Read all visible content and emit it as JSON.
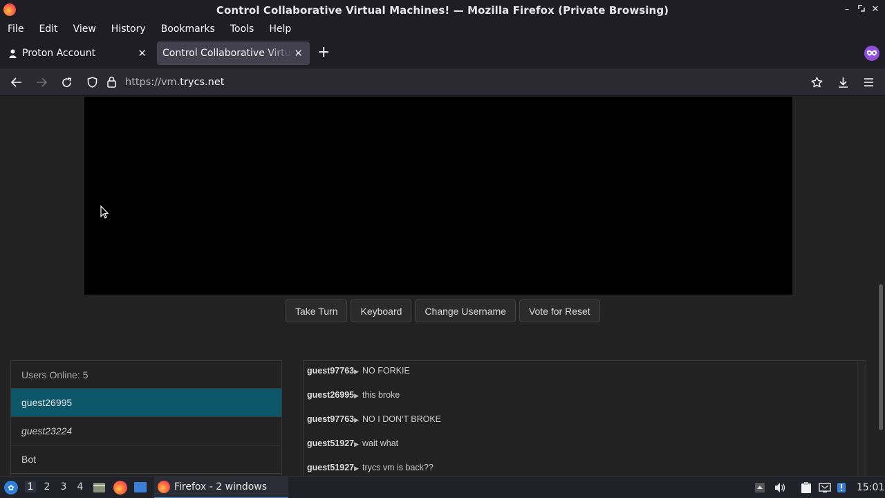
{
  "window": {
    "title": "Control Collaborative Virtual Machines! — Mozilla Firefox (Private Browsing)"
  },
  "menu": {
    "items": [
      "File",
      "Edit",
      "View",
      "History",
      "Bookmarks",
      "Tools",
      "Help"
    ]
  },
  "tabs": [
    {
      "label": "Proton Account",
      "icon": "person-icon",
      "active": false
    },
    {
      "label": "Control Collaborative Virtual Machines!",
      "icon": "none",
      "active": true
    }
  ],
  "nav": {
    "url_prefix": "https://vm.",
    "url_domain": "trycs.net"
  },
  "vm": {
    "buttons": {
      "take_turn": "Take Turn",
      "keyboard": "Keyboard",
      "change_username": "Change Username",
      "vote_reset": "Vote for Reset"
    }
  },
  "users": {
    "header": "Users Online: 5",
    "list": [
      {
        "name": "guest26995",
        "selected": true,
        "italic": false
      },
      {
        "name": "guest23224",
        "selected": false,
        "italic": true
      },
      {
        "name": "Bot",
        "selected": false,
        "italic": false
      }
    ]
  },
  "chat": {
    "messages": [
      {
        "user": "guest97763",
        "text": "NO FORKIE"
      },
      {
        "user": "guest26995",
        "text": "this broke"
      },
      {
        "user": "guest97763",
        "text": "NO I DON'T BROKE"
      },
      {
        "user": "guest51927",
        "text": "wait what"
      },
      {
        "user": "guest51927",
        "text": "trycs vm is back??"
      }
    ]
  },
  "taskbar": {
    "workspaces": [
      "1",
      "2",
      "3",
      "4"
    ],
    "active_app": "Firefox - 2 windows",
    "clock": "15:01"
  },
  "colors": {
    "selected_user": "#0b5669",
    "accent": "#4a90d9"
  }
}
